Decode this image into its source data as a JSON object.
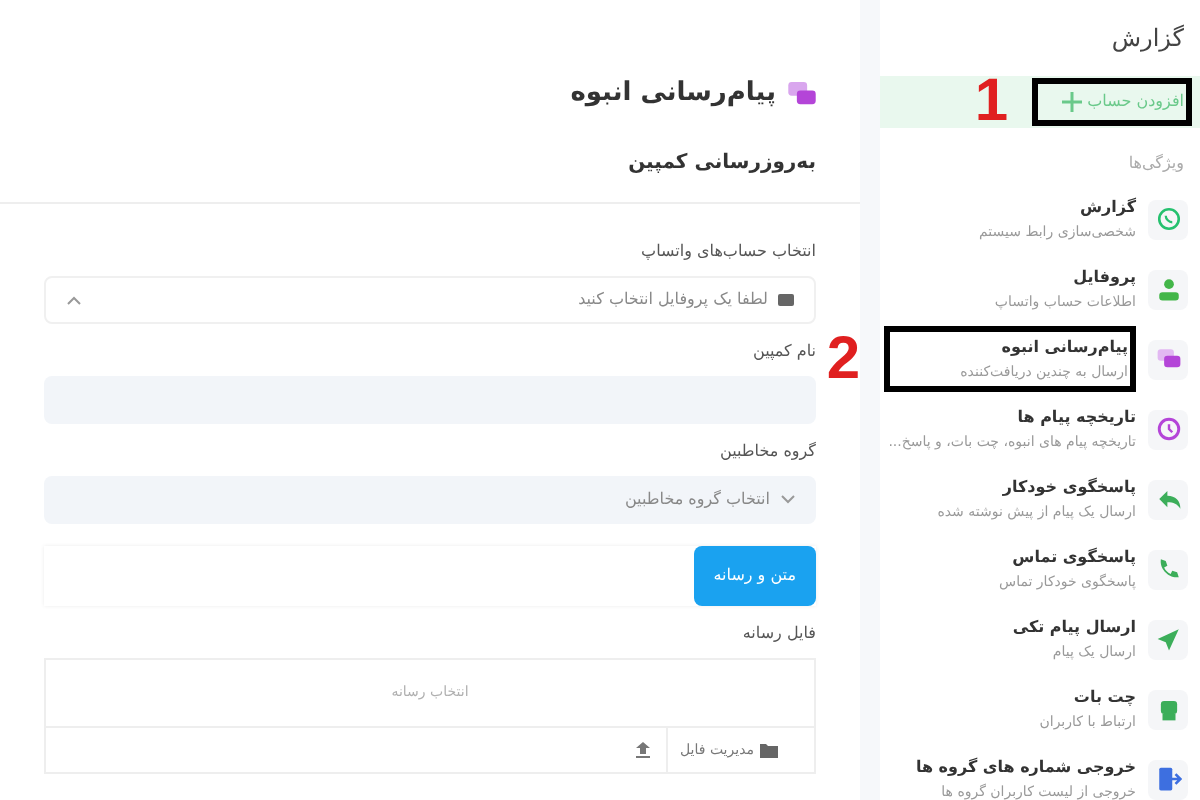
{
  "sidebar": {
    "heading": "گزارش",
    "add_account": {
      "label": "افزودن حساب",
      "annotation": "1"
    },
    "section_label": "ویژگی‌ها",
    "items": [
      {
        "kind": "whatsapp",
        "color": "#25c16f",
        "title": "گزارش",
        "subtitle": "شخصی‌سازی رابط سیستم"
      },
      {
        "kind": "user",
        "color": "#43b649",
        "title": "پروفایل",
        "subtitle": "اطلاعات حساب واتساپ"
      },
      {
        "kind": "chat",
        "color": "#b445d8",
        "title": "پیام‌رسانی انبوه",
        "subtitle": "ارسال به چندین دریافت‌کننده",
        "annotation": "2"
      },
      {
        "kind": "history",
        "color": "#b445d8",
        "title": "تاریخچه پیام ها",
        "subtitle": "تاریخچه پیام های انبوه، چت بات، و پاسخ..."
      },
      {
        "kind": "reply",
        "color": "#3cae5a",
        "title": "پاسخگوی خودکار",
        "subtitle": "ارسال یک پیام از پیش نوشته شده"
      },
      {
        "kind": "phone",
        "color": "#3cae5a",
        "title": "پاسخگوی تماس",
        "subtitle": "پاسخگوی خودکار تماس"
      },
      {
        "kind": "send",
        "color": "#3cae5a",
        "title": "ارسال پیام تکی",
        "subtitle": "ارسال یک پیام"
      },
      {
        "kind": "bot",
        "color": "#3cae5a",
        "title": "چت بات",
        "subtitle": "ارتباط با کاربران"
      },
      {
        "kind": "export",
        "color": "#3d6fe0",
        "title": "خروجی شماره های گروه ها",
        "subtitle": "خروجی از لیست کاربران گروه ها"
      }
    ]
  },
  "main": {
    "title": "پیام‌رسانی انبوه",
    "card_title": "به‌روزرسانی کمپین",
    "fields": [
      {
        "kind": "select",
        "label": "انتخاب حساب‌های واتساپ",
        "placeholder": "لطفا یک پروفایل انتخاب کنید",
        "expanded": true
      },
      {
        "kind": "text",
        "label": "نام کمپین"
      },
      {
        "kind": "select",
        "label": "گروه مخاطبین",
        "placeholder": "انتخاب گروه مخاطبین",
        "expanded": false
      }
    ],
    "tabs": [
      {
        "label": "متن و رسانه",
        "selected": true
      }
    ],
    "media": {
      "label": "فایل رسانه",
      "placeholder": "انتخاب رسانه",
      "file_manager": "مدیریت فایل"
    }
  }
}
